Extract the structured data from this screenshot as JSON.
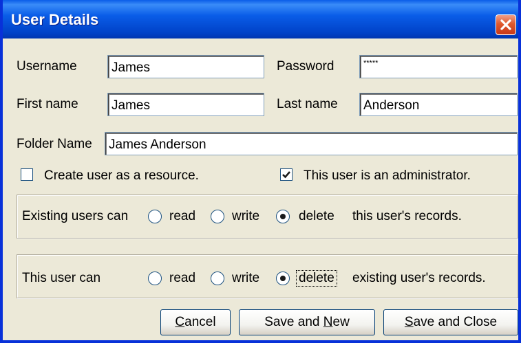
{
  "window": {
    "title": "User Details"
  },
  "fields": {
    "username": {
      "label": "Username",
      "value": "James"
    },
    "password": {
      "label": "Password",
      "value": "*****"
    },
    "first_name": {
      "label": "First name",
      "value": "James"
    },
    "last_name": {
      "label": "Last name",
      "value": "Anderson"
    },
    "folder_name": {
      "label": "Folder Name",
      "value": "James Anderson"
    }
  },
  "checkboxes": {
    "resource": {
      "label": "Create user as a resource.",
      "checked": false
    },
    "admin": {
      "label": "This user is an administrator.",
      "checked": true
    }
  },
  "existing_group": {
    "prefix": "Existing users can",
    "options": [
      "read",
      "write",
      "delete"
    ],
    "selected": "delete",
    "suffix": "this user's records."
  },
  "user_group": {
    "prefix": "This user can",
    "options": [
      "read",
      "write",
      "delete"
    ],
    "selected": "delete",
    "suffix": "existing user's records."
  },
  "buttons": {
    "cancel": {
      "mnemonic": "C",
      "rest": "ancel"
    },
    "save_new": {
      "pre": "Save and ",
      "mnemonic": "N",
      "rest": "ew"
    },
    "save_close": {
      "mnemonic": "S",
      "rest": "ave and Close"
    }
  },
  "colors": {
    "titlebar": "#0a5de8",
    "dialog_bg": "#ece9d8",
    "close": "#e0592d"
  },
  "icons": {
    "close": "close-icon",
    "check": "checkmark-icon"
  }
}
